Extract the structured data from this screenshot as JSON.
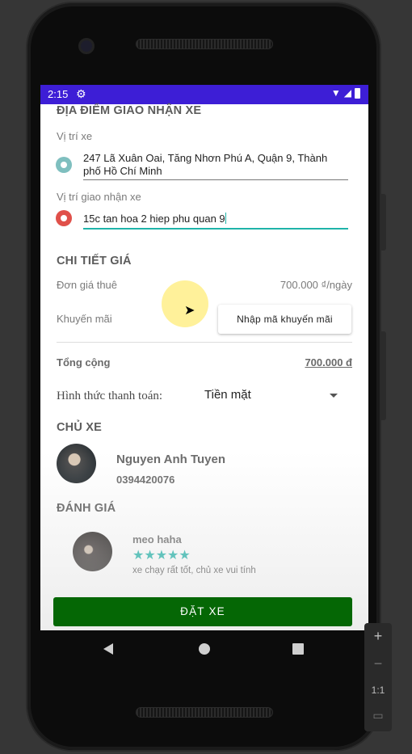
{
  "status_bar": {
    "time": "2:15"
  },
  "sections": {
    "delivery_title": "ĐỊA ĐIỂM GIAO NHẬN XE",
    "price_title": "CHI TIẾT GIÁ",
    "owner_title": "CHỦ XE",
    "review_title": "ĐÁNH GIÁ"
  },
  "delivery": {
    "car_location_label": "Vị trí xe",
    "car_location_value_line1": "247 Lã Xuân Oai, Tăng Nhơn Phú A, Quận 9, Thành",
    "car_location_value_line2": "phố Hồ Chí Minh",
    "handover_label": "Vị trí giao nhận xe",
    "handover_value": "15c tan hoa 2 hiep phu quan 9"
  },
  "price": {
    "unit_label": "Đơn giá thuê",
    "unit_value": "700.000 ₫/ngày",
    "promo_label": "Khuyến mãi",
    "promo_button": "Nhập mã khuyến mãi",
    "total_label": "Tổng cộng",
    "total_value": "700.000 đ",
    "payment_label": "Hình thức thanh toán:",
    "payment_value": "Tiền mặt"
  },
  "owner": {
    "name": "Nguyen Anh Tuyen",
    "phone": "0394420076"
  },
  "review": {
    "reviewer": "meo haha",
    "stars": "★★★★★",
    "rating": 5,
    "comment": "xe chạy rất tốt, chủ xe vui tính"
  },
  "actions": {
    "book_label": "ĐẶT XE"
  },
  "emulator": {
    "zoom_in": "+",
    "zoom_out": "−",
    "one_to_one": "1:1"
  },
  "colors": {
    "status_bar": "#3d1ed6",
    "accent_teal": "#1fb3a9",
    "book_button": "#056705",
    "pin_red": "#e0504a",
    "pin_teal": "#7fbfbf"
  }
}
